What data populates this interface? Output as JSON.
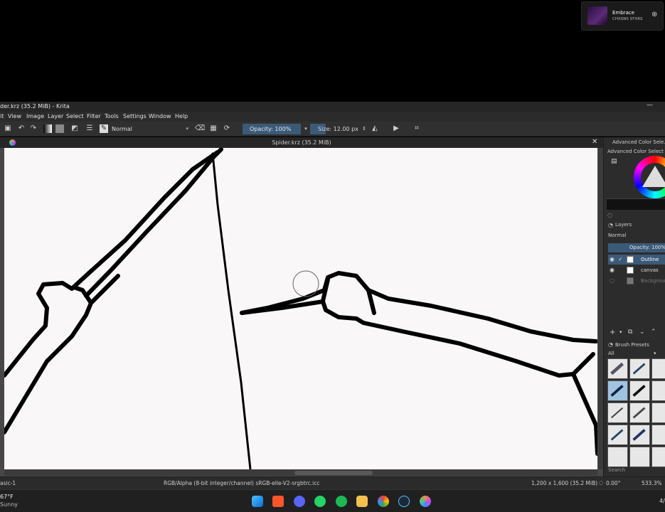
{
  "media": {
    "title": "Embrace",
    "artist": "CHXSNS STXRS",
    "add_icon": "add-circle-icon"
  },
  "window": {
    "title": "der.krz (35.2 MiB)  - Krita",
    "minimize_icon": "minimize-icon"
  },
  "menu": [
    "it",
    "View",
    "Image",
    "Layer",
    "Select",
    "Filter",
    "Tools",
    "Settings",
    "Window",
    "Help"
  ],
  "toolbar": {
    "blend_mode": "Normal",
    "opacity": "Opacity: 100%",
    "size": "Size: 12.00 px"
  },
  "document": {
    "tab_title": "Spider.krz (35.2 MiB)",
    "close_icon": "close-icon"
  },
  "dock": {
    "color_selector_title": "Advanced Color Sele...",
    "color_selector_subtitle": "Advanced Color Select",
    "layers_title": "Layers",
    "layers_blend": "Normal",
    "layers_opacity": "Opacity: 100%",
    "layers": [
      {
        "name": "Outline",
        "selected": true
      },
      {
        "name": "canvas",
        "selected": false
      },
      {
        "name": "Backgroun",
        "selected": false
      }
    ],
    "brush_presets_title": "Brush Presets",
    "brush_filter": "All",
    "search_label": "Search"
  },
  "status": {
    "brush": "asic-1",
    "color_space": "RGB/Alpha (8-bit integer/channel)  sRGB-elle-V2-srgbtrc.icc",
    "dimensions": "1,200 x 1,600 (35.2 MiB)",
    "rotation": "0.00°",
    "zoom": "533.3%"
  },
  "taskbar": {
    "temperature": "67°F",
    "weather": "Sunny",
    "clock": "4/",
    "apps": [
      "start-icon",
      "brave-icon",
      "discord-icon",
      "whatsapp-icon",
      "spotify-icon",
      "file-explorer-icon",
      "chrome-icon",
      "steam-icon",
      "krita-icon"
    ]
  },
  "colors": {
    "accent": "#3b5a78",
    "canvas": "#f9f7f8",
    "stroke": "#000000"
  }
}
